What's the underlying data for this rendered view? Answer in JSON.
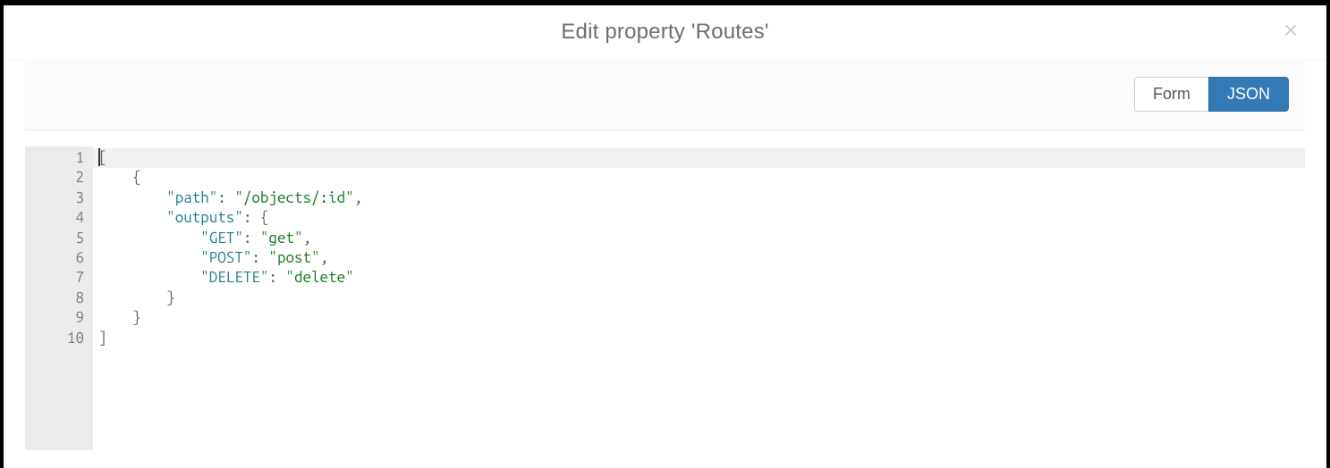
{
  "header": {
    "title": "Edit property 'Routes'",
    "close_icon": "×"
  },
  "toolbar": {
    "tabs": [
      {
        "label": "Form",
        "active": false
      },
      {
        "label": "JSON",
        "active": true
      }
    ]
  },
  "editor": {
    "active_line": 1,
    "lines": [
      {
        "num": 1,
        "foldable": true
      },
      {
        "num": 2,
        "foldable": true
      },
      {
        "num": 3,
        "foldable": false
      },
      {
        "num": 4,
        "foldable": true
      },
      {
        "num": 5,
        "foldable": false
      },
      {
        "num": 6,
        "foldable": false
      },
      {
        "num": 7,
        "foldable": false
      },
      {
        "num": 8,
        "foldable": false
      },
      {
        "num": 9,
        "foldable": false
      },
      {
        "num": 10,
        "foldable": false
      }
    ],
    "code": {
      "line1": {
        "open": "["
      },
      "line2": {
        "open": "{"
      },
      "line3": {
        "key": "\"path\"",
        "colon": ": ",
        "val": "\"/objects/:id\"",
        "comma": ","
      },
      "line4": {
        "key": "\"outputs\"",
        "colon": ": ",
        "open": "{"
      },
      "line5": {
        "key": "\"GET\"",
        "colon": ": ",
        "val": "\"get\"",
        "comma": ","
      },
      "line6": {
        "key": "\"POST\"",
        "colon": ": ",
        "val": "\"post\"",
        "comma": ","
      },
      "line7": {
        "key": "\"DELETE\"",
        "colon": ": ",
        "val": "\"delete\""
      },
      "line8": {
        "close": "}"
      },
      "line9": {
        "close": "}"
      },
      "line10": {
        "close": "]"
      }
    }
  }
}
